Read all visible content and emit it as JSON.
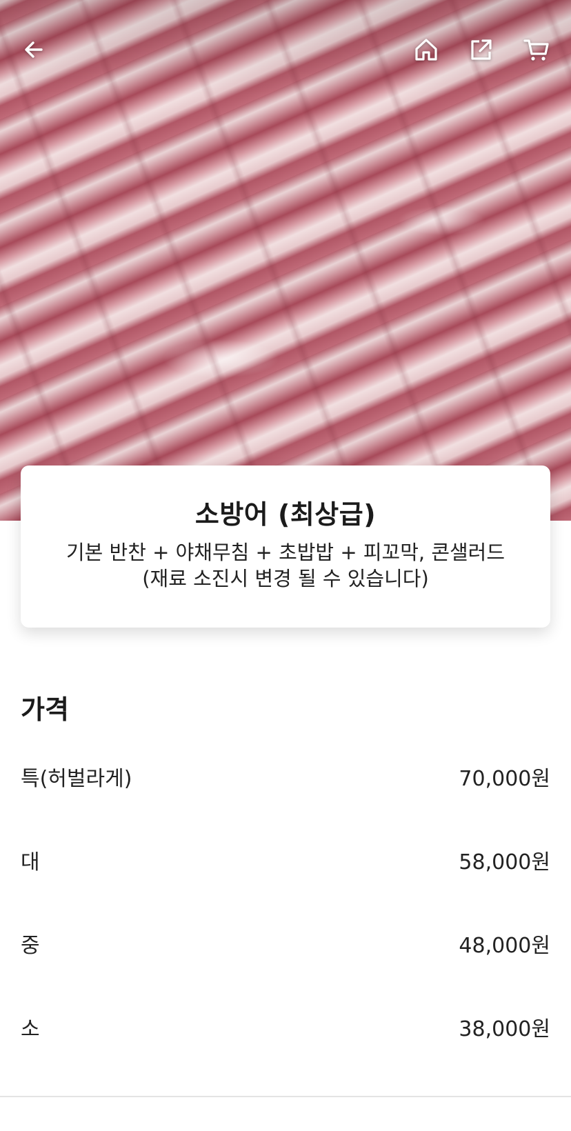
{
  "product": {
    "title": "소방어 (최상급)",
    "description_line1": "기본 반찬 + 야채무침 + 초밥밥 + 피꼬막, 콘샐러드",
    "description_line2": "(재료 소진시 변경 될 수 있습니다)"
  },
  "topbar": {
    "icons": [
      "back-arrow-icon",
      "home-icon",
      "share-icon",
      "cart-icon"
    ]
  },
  "price": {
    "heading": "가격",
    "options": [
      {
        "label": "특(허벌라게)",
        "price": "70,000원"
      },
      {
        "label": "대",
        "price": "58,000원"
      },
      {
        "label": "중",
        "price": "48,000원"
      },
      {
        "label": "소",
        "price": "38,000원"
      }
    ]
  },
  "colors": {
    "text": "#1f1f1f",
    "divider": "#e4e4e4",
    "card_bg": "#ffffff"
  }
}
